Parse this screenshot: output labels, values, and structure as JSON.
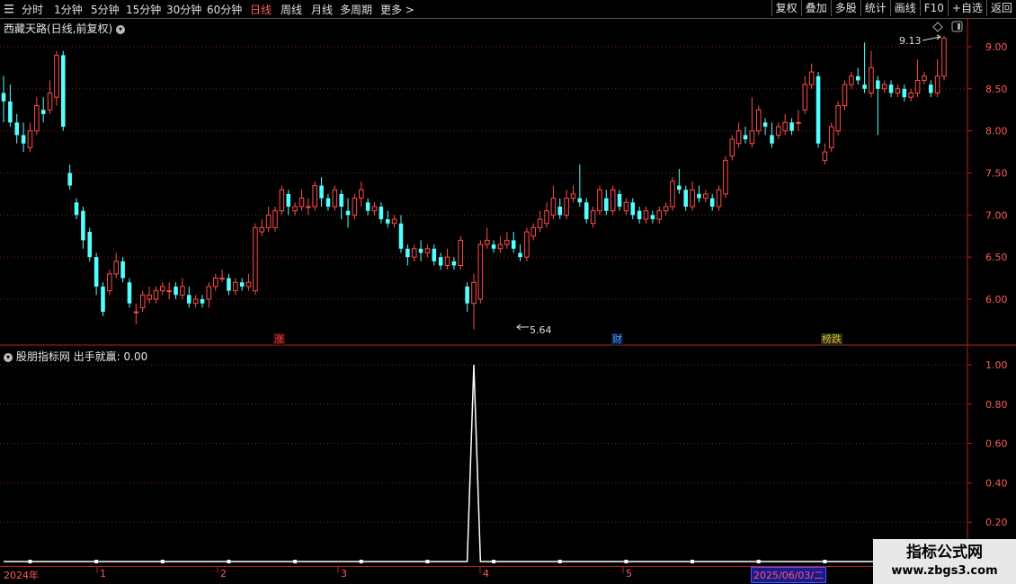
{
  "toolbar": {
    "left_items": [
      "分时",
      "1分钟",
      "5分钟",
      "15分钟",
      "30分钟",
      "60分钟",
      "日线",
      "周线",
      "月线",
      "多周期",
      "更多 >"
    ],
    "active_item": "日线",
    "right_items": [
      "复权",
      "叠加",
      "多股",
      "统计",
      "画线",
      "F10",
      "+自选",
      "返回"
    ]
  },
  "main_chart": {
    "title": "西藏天路(日线,前复权)",
    "y_axis_ticks": [
      "9.00",
      "8.50",
      "8.00",
      "7.50",
      "7.00",
      "6.50",
      "6.00"
    ],
    "high_label": "9.13",
    "low_label": "5.64",
    "tags": [
      {
        "text": "涨",
        "color": "#ff4040"
      },
      {
        "text": "财",
        "color": "#3a8cff"
      },
      {
        "text": "榜跌",
        "color": "#b5a21e"
      }
    ]
  },
  "indicator": {
    "name": "股朋指标网",
    "label": "出手就赢:",
    "value": "0.00",
    "y_axis_ticks": [
      "1.00",
      "0.80",
      "0.60",
      "0.40",
      "0.20"
    ]
  },
  "date_axis": {
    "labels": [
      "2024年",
      "1",
      "2",
      "3",
      "4",
      "5"
    ],
    "highlight": "2025/06/03/二"
  },
  "watermark": {
    "line1": "指标公式网",
    "line2": "www.zbgs3.com"
  },
  "colors": {
    "up": "#ff4b4b",
    "down": "#54ffff",
    "grid": "#8b1a1a",
    "axis": "#b22222"
  },
  "chart_data": {
    "type": "candlestick",
    "title": "西藏天路(日线,前复权)",
    "ylim": [
      5.5,
      9.3
    ],
    "candles": [
      [
        8.45,
        8.35,
        8.65,
        8.1
      ],
      [
        8.35,
        8.1,
        8.55,
        8.05
      ],
      [
        8.1,
        7.95,
        8.2,
        7.85
      ],
      [
        7.95,
        7.85,
        8.1,
        7.75
      ],
      [
        7.8,
        8.0,
        8.1,
        7.75
      ],
      [
        8.0,
        8.3,
        8.4,
        7.95
      ],
      [
        8.25,
        8.2,
        8.4,
        8.1
      ],
      [
        8.25,
        8.45,
        8.6,
        8.2
      ],
      [
        8.4,
        8.9,
        8.95,
        8.3
      ],
      [
        8.9,
        8.05,
        8.95,
        8.0
      ],
      [
        7.5,
        7.35,
        7.6,
        7.3
      ],
      [
        7.15,
        7.0,
        7.2,
        6.95
      ],
      [
        7.05,
        6.7,
        7.1,
        6.6
      ],
      [
        6.8,
        6.5,
        6.85,
        6.45
      ],
      [
        6.5,
        6.15,
        6.55,
        6.05
      ],
      [
        6.15,
        5.85,
        6.2,
        5.8
      ],
      [
        6.1,
        6.3,
        6.35,
        6.05
      ],
      [
        6.3,
        6.45,
        6.55,
        6.25
      ],
      [
        6.45,
        6.25,
        6.5,
        6.2
      ],
      [
        6.2,
        5.95,
        6.25,
        5.9
      ],
      [
        5.85,
        5.85,
        5.95,
        5.7
      ],
      [
        5.9,
        6.05,
        6.1,
        5.85
      ],
      [
        6.0,
        6.05,
        6.15,
        5.95
      ],
      [
        6.0,
        6.1,
        6.15,
        5.95
      ],
      [
        6.1,
        6.15,
        6.2,
        6.05
      ],
      [
        6.1,
        6.1,
        6.2,
        6.0
      ],
      [
        6.15,
        6.05,
        6.2,
        6.0
      ],
      [
        6.05,
        6.15,
        6.25,
        6.0
      ],
      [
        6.05,
        5.95,
        6.15,
        5.9
      ],
      [
        5.95,
        6.0,
        6.05,
        5.9
      ],
      [
        6.0,
        5.95,
        6.05,
        5.9
      ],
      [
        6.0,
        6.15,
        6.2,
        5.9
      ],
      [
        6.15,
        6.25,
        6.3,
        6.1
      ],
      [
        6.25,
        6.25,
        6.35,
        6.2
      ],
      [
        6.25,
        6.1,
        6.3,
        6.05
      ],
      [
        6.1,
        6.2,
        6.25,
        6.05
      ],
      [
        6.2,
        6.15,
        6.25,
        6.1
      ],
      [
        6.15,
        6.2,
        6.3,
        6.1
      ],
      [
        6.1,
        6.85,
        6.9,
        6.05
      ],
      [
        6.8,
        6.85,
        6.95,
        6.75
      ],
      [
        6.85,
        7.0,
        7.1,
        6.8
      ],
      [
        6.85,
        7.05,
        7.1,
        6.8
      ],
      [
        7.05,
        7.3,
        7.35,
        7.0
      ],
      [
        7.25,
        7.1,
        7.3,
        7.0
      ],
      [
        7.05,
        7.1,
        7.15,
        7.0
      ],
      [
        7.1,
        7.2,
        7.3,
        7.05
      ],
      [
        7.1,
        7.1,
        7.2,
        7.0
      ],
      [
        7.1,
        7.35,
        7.4,
        7.05
      ],
      [
        7.35,
        7.2,
        7.45,
        7.1
      ],
      [
        7.2,
        7.1,
        7.25,
        7.05
      ],
      [
        7.1,
        7.3,
        7.35,
        7.05
      ],
      [
        7.25,
        7.1,
        7.3,
        6.95
      ],
      [
        7.05,
        7.0,
        7.2,
        6.85
      ],
      [
        7.0,
        7.2,
        7.25,
        6.95
      ],
      [
        7.2,
        7.3,
        7.4,
        7.1
      ],
      [
        7.15,
        7.05,
        7.2,
        7.0
      ],
      [
        7.05,
        7.1,
        7.15,
        7.0
      ],
      [
        7.1,
        6.95,
        7.15,
        6.9
      ],
      [
        6.95,
        6.9,
        7.05,
        6.85
      ],
      [
        6.9,
        6.95,
        7.0,
        6.85
      ],
      [
        6.9,
        6.6,
        7.0,
        6.55
      ],
      [
        6.6,
        6.5,
        6.65,
        6.4
      ],
      [
        6.5,
        6.6,
        6.65,
        6.45
      ],
      [
        6.6,
        6.55,
        6.7,
        6.45
      ],
      [
        6.55,
        6.6,
        6.65,
        6.5
      ],
      [
        6.6,
        6.45,
        6.65,
        6.4
      ],
      [
        6.5,
        6.4,
        6.55,
        6.35
      ],
      [
        6.4,
        6.5,
        6.6,
        6.35
      ],
      [
        6.45,
        6.4,
        6.5,
        6.35
      ],
      [
        6.4,
        6.7,
        6.75,
        6.35
      ],
      [
        6.15,
        5.95,
        6.2,
        5.85
      ],
      [
        5.95,
        6.2,
        6.3,
        5.64
      ],
      [
        6.0,
        6.65,
        6.7,
        5.95
      ],
      [
        6.65,
        6.7,
        6.85,
        6.6
      ],
      [
        6.65,
        6.6,
        6.7,
        6.55
      ],
      [
        6.6,
        6.65,
        6.75,
        6.55
      ],
      [
        6.65,
        6.7,
        6.8,
        6.6
      ],
      [
        6.7,
        6.6,
        6.8,
        6.55
      ],
      [
        6.55,
        6.5,
        6.65,
        6.45
      ],
      [
        6.5,
        6.8,
        6.85,
        6.45
      ],
      [
        6.75,
        6.85,
        6.9,
        6.7
      ],
      [
        6.85,
        6.95,
        7.05,
        6.8
      ],
      [
        6.9,
        7.05,
        7.15,
        6.85
      ],
      [
        7.0,
        7.2,
        7.35,
        6.95
      ],
      [
        7.1,
        7.0,
        7.2,
        6.95
      ],
      [
        7.0,
        7.2,
        7.3,
        6.95
      ],
      [
        7.2,
        7.25,
        7.35,
        7.15
      ],
      [
        7.2,
        7.15,
        7.6,
        7.1
      ],
      [
        7.15,
        6.95,
        7.2,
        6.9
      ],
      [
        6.9,
        7.05,
        7.1,
        6.85
      ],
      [
        7.05,
        7.3,
        7.35,
        7.0
      ],
      [
        7.2,
        7.05,
        7.3,
        7.0
      ],
      [
        7.05,
        7.3,
        7.35,
        7.0
      ],
      [
        7.25,
        7.1,
        7.3,
        7.05
      ],
      [
        7.05,
        7.15,
        7.2,
        7.0
      ],
      [
        7.15,
        7.0,
        7.2,
        6.95
      ],
      [
        7.05,
        6.95,
        7.1,
        6.9
      ],
      [
        6.95,
        7.05,
        7.1,
        6.9
      ],
      [
        7.0,
        6.95,
        7.05,
        6.9
      ],
      [
        6.95,
        7.05,
        7.1,
        6.9
      ],
      [
        7.05,
        7.1,
        7.15,
        7.0
      ],
      [
        7.1,
        7.4,
        7.45,
        7.05
      ],
      [
        7.35,
        7.3,
        7.55,
        7.25
      ],
      [
        7.3,
        7.1,
        7.35,
        7.05
      ],
      [
        7.1,
        7.3,
        7.4,
        7.05
      ],
      [
        7.25,
        7.2,
        7.35,
        7.15
      ],
      [
        7.2,
        7.25,
        7.3,
        7.15
      ],
      [
        7.2,
        7.1,
        7.25,
        7.05
      ],
      [
        7.1,
        7.3,
        7.35,
        7.05
      ],
      [
        7.25,
        7.65,
        7.7,
        7.2
      ],
      [
        7.7,
        7.9,
        7.95,
        7.65
      ],
      [
        7.85,
        8.0,
        8.1,
        7.8
      ],
      [
        7.95,
        7.9,
        8.05,
        7.85
      ],
      [
        7.85,
        8.0,
        8.4,
        7.8
      ],
      [
        8.0,
        8.25,
        8.3,
        7.95
      ],
      [
        8.1,
        8.05,
        8.15,
        7.95
      ],
      [
        7.95,
        7.85,
        8.1,
        7.8
      ],
      [
        7.95,
        8.05,
        8.1,
        7.9
      ],
      [
        8.0,
        8.1,
        8.2,
        7.95
      ],
      [
        8.1,
        8.0,
        8.15,
        7.95
      ],
      [
        8.1,
        8.1,
        8.25,
        8.0
      ],
      [
        8.25,
        8.55,
        8.65,
        8.2
      ],
      [
        8.55,
        8.7,
        8.8,
        8.5
      ],
      [
        8.65,
        7.85,
        8.7,
        7.8
      ],
      [
        7.65,
        7.75,
        7.85,
        7.6
      ],
      [
        7.8,
        8.05,
        8.1,
        7.75
      ],
      [
        8.0,
        8.3,
        8.35,
        7.95
      ],
      [
        8.3,
        8.55,
        8.6,
        8.25
      ],
      [
        8.55,
        8.65,
        8.7,
        8.5
      ],
      [
        8.65,
        8.6,
        8.75,
        8.55
      ],
      [
        8.55,
        8.5,
        9.05,
        8.45
      ],
      [
        8.45,
        8.75,
        8.95,
        8.4
      ],
      [
        8.6,
        8.5,
        8.65,
        7.95
      ],
      [
        8.5,
        8.55,
        8.6,
        8.45
      ],
      [
        8.55,
        8.45,
        8.6,
        8.4
      ],
      [
        8.45,
        8.5,
        8.55,
        8.4
      ],
      [
        8.5,
        8.4,
        8.55,
        8.35
      ],
      [
        8.4,
        8.45,
        8.5,
        8.35
      ],
      [
        8.45,
        8.6,
        8.85,
        8.4
      ],
      [
        8.6,
        8.65,
        8.7,
        8.55
      ],
      [
        8.55,
        8.45,
        8.6,
        8.4
      ],
      [
        8.45,
        8.65,
        8.85,
        8.4
      ],
      [
        8.65,
        9.1,
        9.13,
        8.6
      ]
    ],
    "indicator_series": {
      "name": "出手就赢",
      "values_nonzero": {
        "index": 71,
        "value": 1.0
      }
    }
  }
}
